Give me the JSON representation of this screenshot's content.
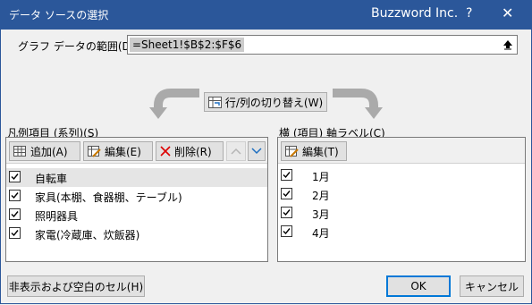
{
  "window": {
    "title": "データ ソースの選択",
    "brand": "Buzzword Inc.",
    "help_label": "?",
    "close_label": "✕"
  },
  "range": {
    "label": "グラフ データの範囲(D):",
    "value": "=Sheet1!$B$2:$F$6"
  },
  "switch_button": {
    "label": "行/列の切り替え(W)"
  },
  "legend": {
    "label": "凡例項目 (系列)(S)",
    "buttons": {
      "add": "追加(A)",
      "edit": "編集(E)",
      "delete": "削除(R)"
    },
    "items": [
      {
        "label": "自転車",
        "checked": true,
        "selected": true
      },
      {
        "label": "家具(本棚、食器棚、テーブル)",
        "checked": true,
        "selected": false
      },
      {
        "label": "照明器具",
        "checked": true,
        "selected": false
      },
      {
        "label": "家電(冷蔵庫、炊飯器)",
        "checked": true,
        "selected": false
      }
    ]
  },
  "axis": {
    "label": "横 (項目) 軸ラベル(C)",
    "buttons": {
      "edit": "編集(T)"
    },
    "items": [
      {
        "label": "1月",
        "checked": true
      },
      {
        "label": "2月",
        "checked": true
      },
      {
        "label": "3月",
        "checked": true
      },
      {
        "label": "4月",
        "checked": true
      }
    ]
  },
  "footer": {
    "hidden_cells": "非表示および空白のセル(H)",
    "ok": "OK",
    "cancel": "キャンセル"
  },
  "colors": {
    "titlebar": "#2b579a",
    "selection": "#e5e5e5",
    "ok_border": "#0078d7"
  }
}
